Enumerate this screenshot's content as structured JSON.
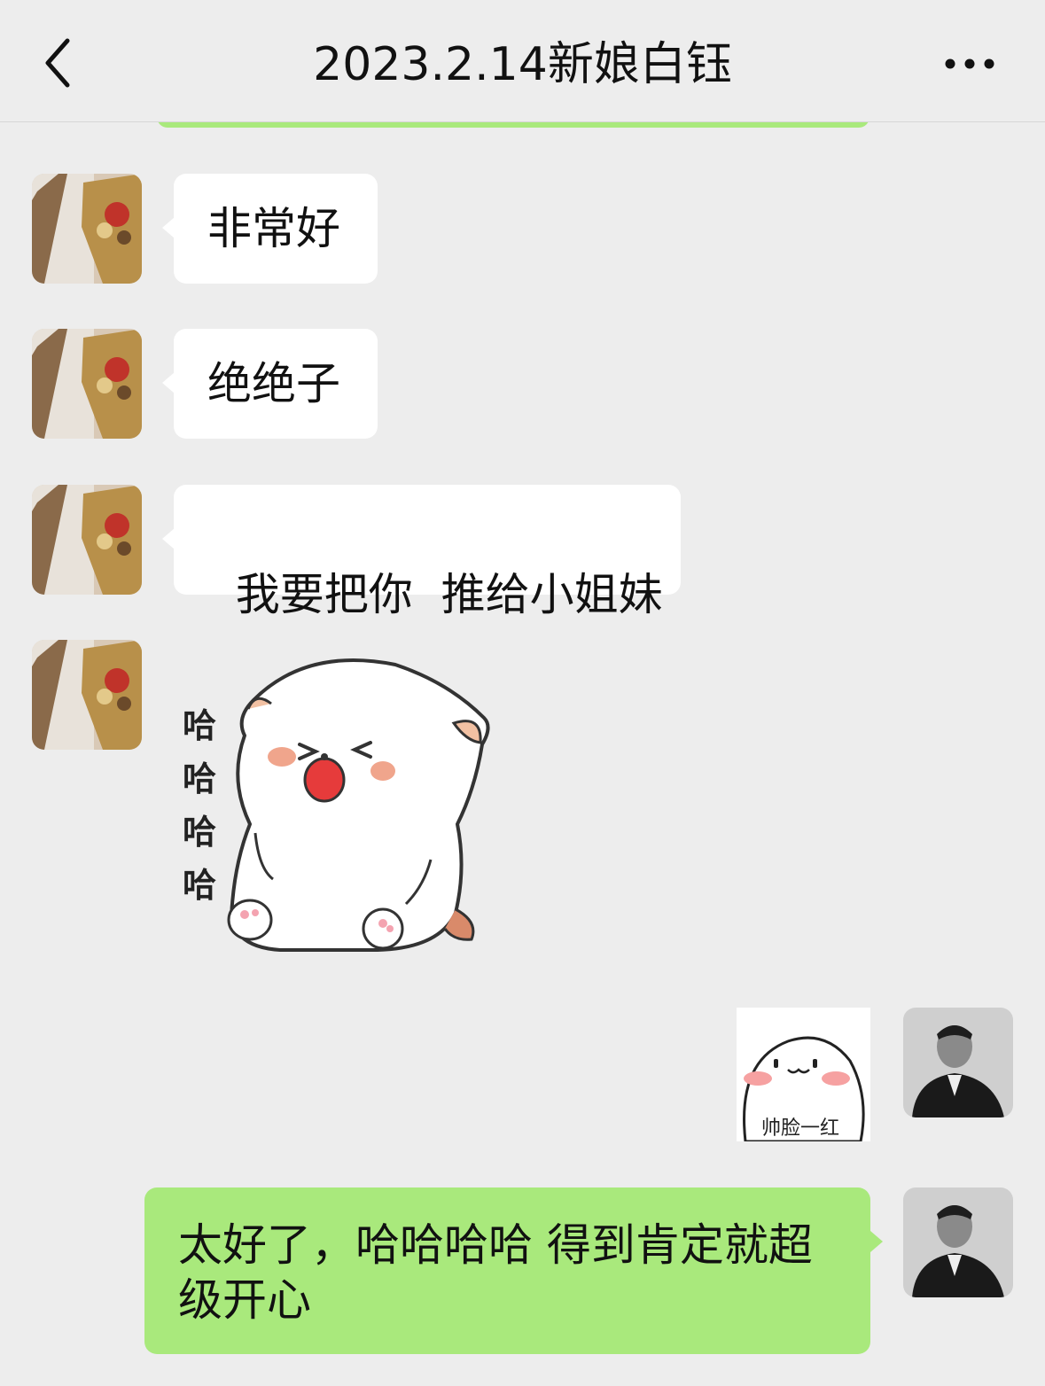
{
  "header": {
    "title": "2023.2.14新娘白钰",
    "back_icon": "chevron-left-icon",
    "more_icon": "more-dots-icon"
  },
  "messages": [
    {
      "sender": "contact",
      "type": "text",
      "text": "非常好"
    },
    {
      "sender": "contact",
      "type": "text",
      "text": "绝绝子"
    },
    {
      "sender": "contact",
      "type": "text",
      "text": "我要把你  推给小姐妹"
    },
    {
      "sender": "contact",
      "type": "sticker",
      "sticker_text": [
        "哈",
        "哈",
        "哈",
        "哈"
      ]
    },
    {
      "sender": "me",
      "type": "sticker",
      "sticker_caption": "帅脸一红"
    },
    {
      "sender": "me",
      "type": "text",
      "text_line1": "太好了，哈哈哈哈 得到肯定就超",
      "text_line2": "级开心"
    }
  ],
  "colors": {
    "background": "#ededed",
    "outgoing_bubble": "#a9e97c",
    "incoming_bubble": "#ffffff"
  }
}
